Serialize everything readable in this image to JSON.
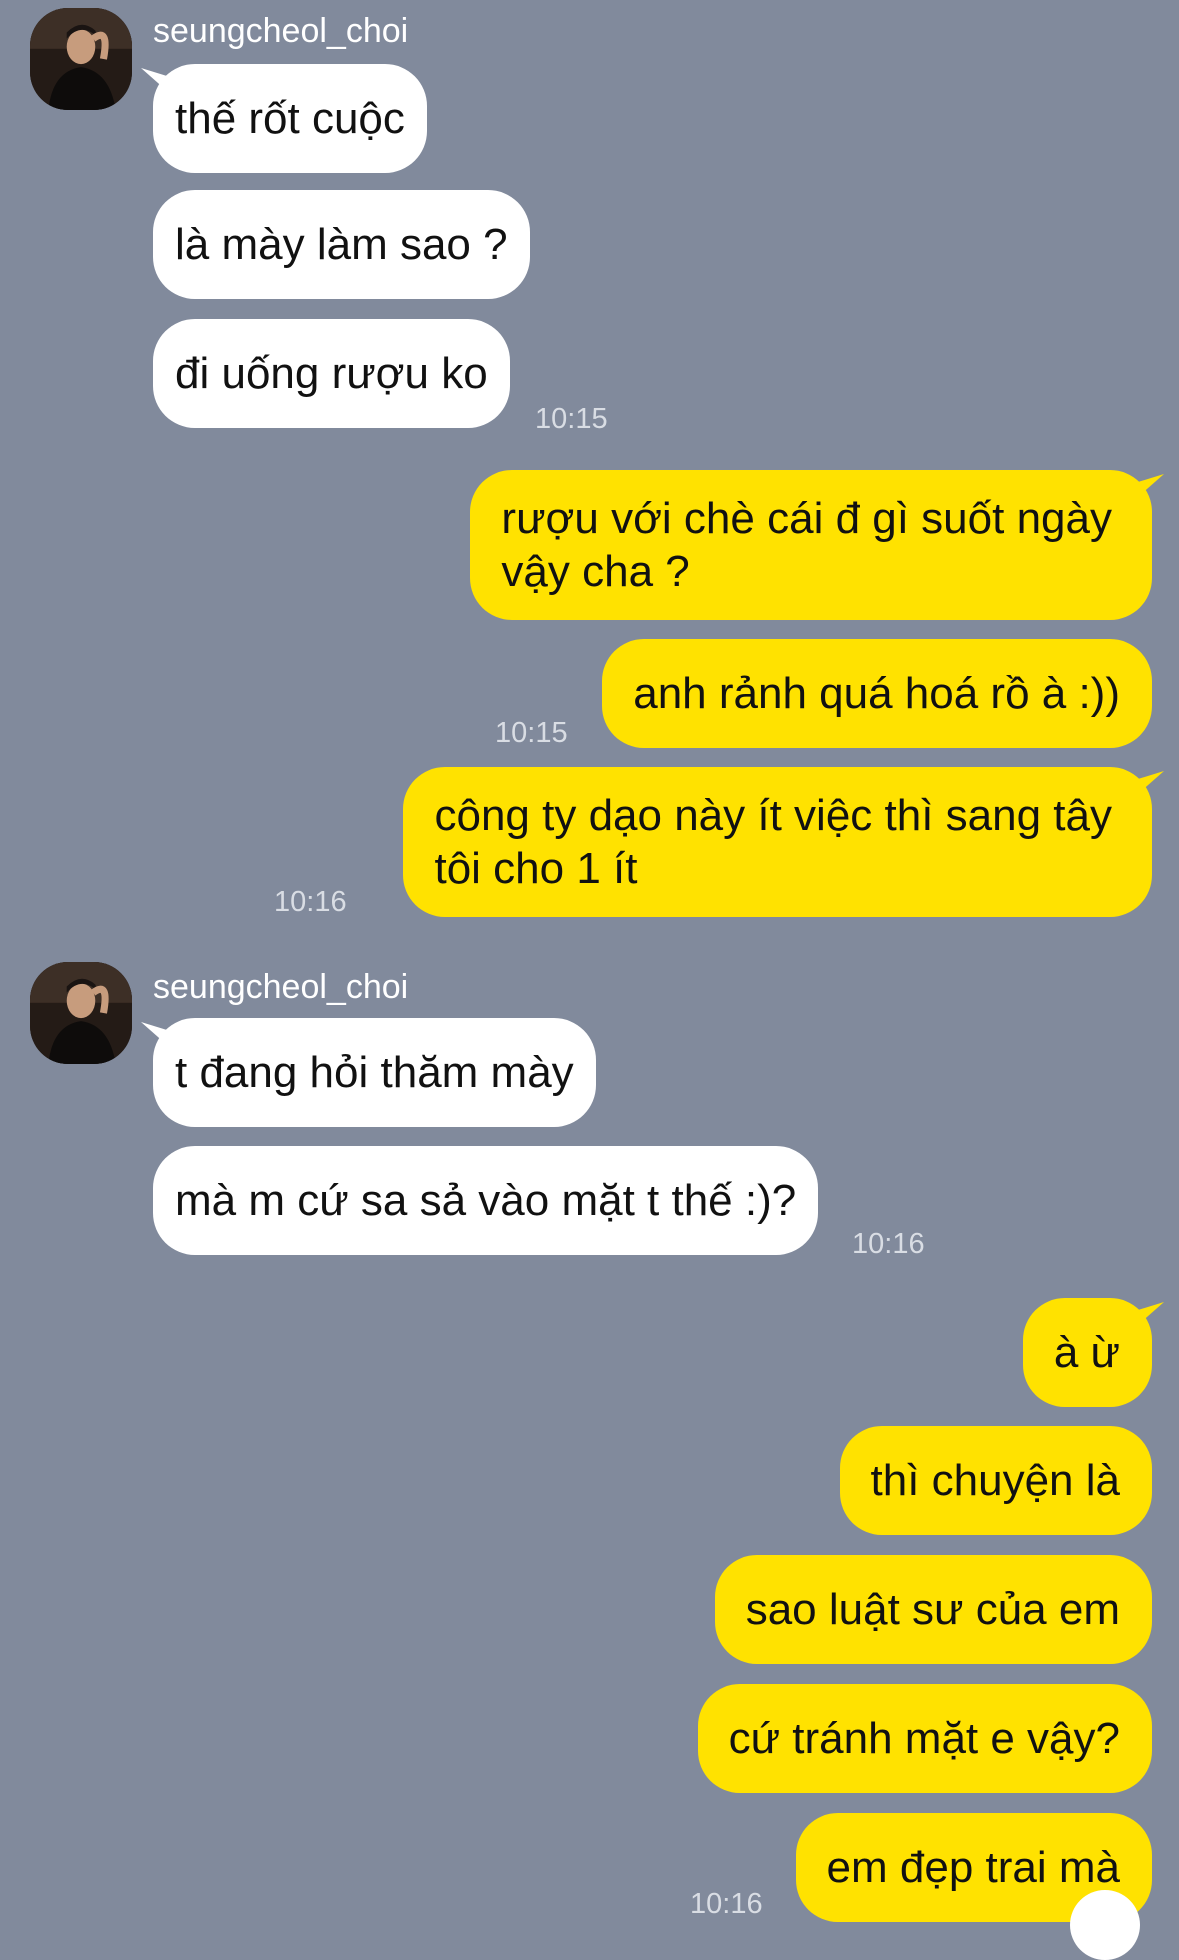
{
  "messages": {
    "g1": {
      "sender": "seungcheol_choi",
      "m1": "thế rốt cuộc",
      "m2": "là mày làm sao ?",
      "m3": "đi uống rượu ko",
      "time": "10:15"
    },
    "g2": {
      "m1_l1": "rượu với chè cái đ gì suốt ngày",
      "m1_l2": "vậy cha ?",
      "m2": "anh rảnh quá hoá rồ à :))",
      "time": "10:15"
    },
    "g3": {
      "m1_l1": "công ty dạo này ít việc thì sang tây",
      "m1_l2": "tôi cho 1 ít",
      "time": "10:16"
    },
    "g4": {
      "sender": "seungcheol_choi",
      "m1": "t đang hỏi thăm mày",
      "m2": "mà m cứ sa sả vào mặt t thế :)?",
      "time": "10:16"
    },
    "g5": {
      "m1": "à ừ",
      "m2": "thì chuyện là",
      "m3": "sao luật sư của em",
      "m4": "cứ tránh mặt e vậy?",
      "m5": "em đẹp trai mà",
      "time": "10:16"
    }
  },
  "colors": {
    "background": "#818a9c",
    "incoming": "#ffffff",
    "outgoing": "#ffe200"
  },
  "icons": {
    "avatar": "profile-photo"
  }
}
